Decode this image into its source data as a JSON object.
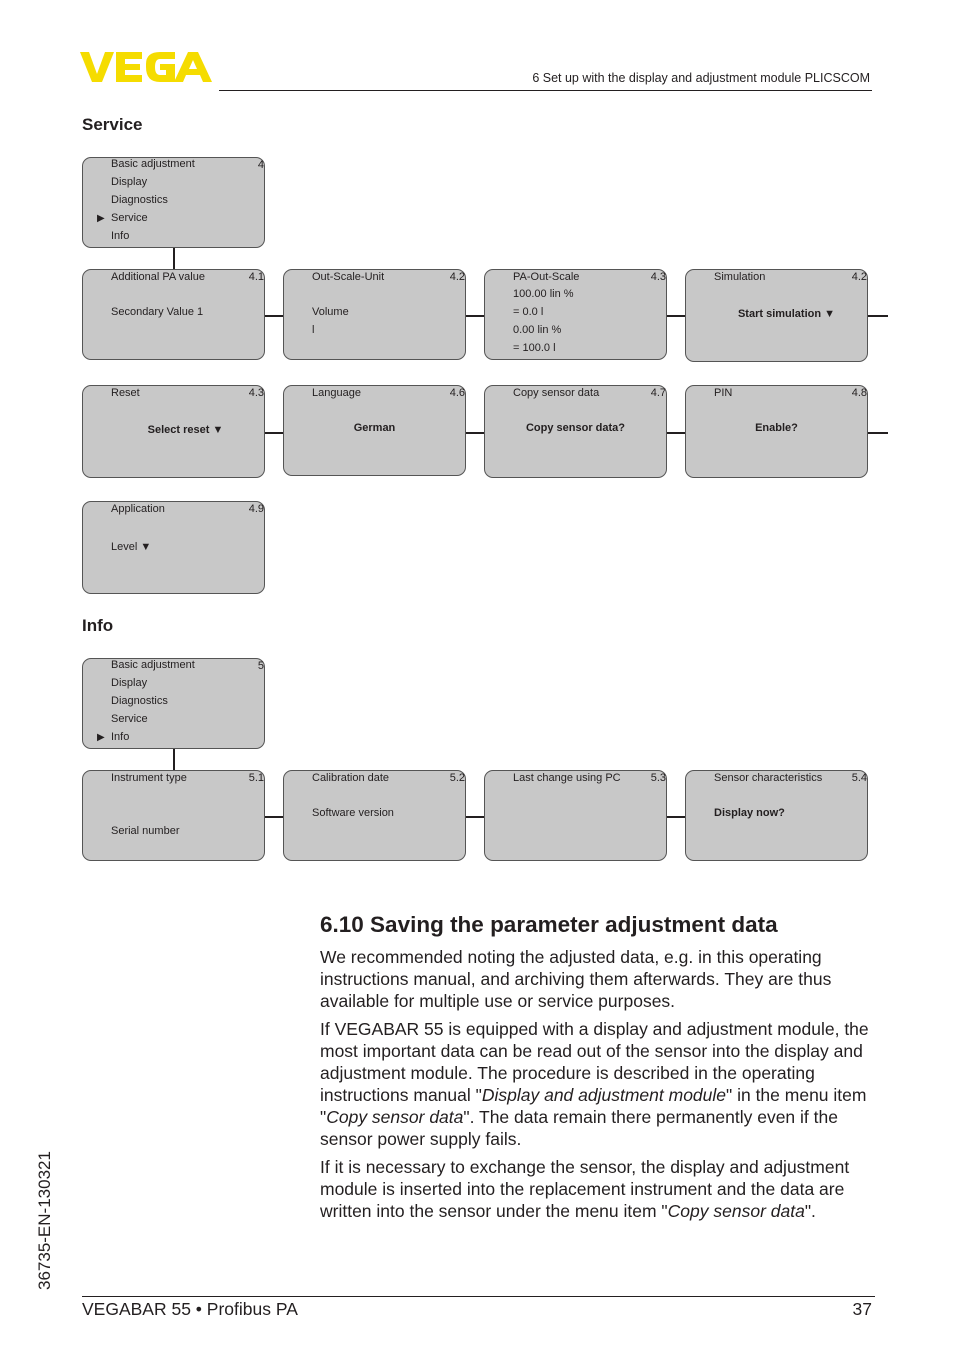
{
  "header": {
    "logo_text": "VEGA",
    "brand_color": "#f5dc00",
    "chapter_title": "6 Set up with the display and adjustment module PLICSCOM"
  },
  "service": {
    "heading": "Service",
    "menu": {
      "items": [
        "Basic adjustment",
        "Display",
        "Diagnostics",
        "Service",
        "Info"
      ],
      "selected_index": 3,
      "number": "4"
    },
    "boxes": [
      {
        "title": "Additional PA value",
        "num": "4.1",
        "lines": [
          "Secondary Value 1"
        ]
      },
      {
        "title": "Out-Scale-Unit",
        "num": "4.2",
        "lines": [
          "Volume",
          "l"
        ]
      },
      {
        "title": "PA-Out-Scale",
        "num": "4.3",
        "lines": [
          "100.00 lin %",
          "= 0.0 l",
          "0.00 lin %",
          "= 100.0 l"
        ]
      },
      {
        "title": "Simulation",
        "num": "4.2",
        "action": "Start simulation ▼"
      },
      {
        "title": "Reset",
        "num": "4.3",
        "action": "Select reset ▼"
      },
      {
        "title": "Language",
        "num": "4.6",
        "action": "German"
      },
      {
        "title": "Copy sensor data",
        "num": "4.7",
        "action": "Copy sensor data?"
      },
      {
        "title": "PIN",
        "num": "4.8",
        "action": "Enable?"
      },
      {
        "title": "Application",
        "num": "4.9",
        "lines": [
          "Level ▼"
        ]
      }
    ]
  },
  "info": {
    "heading": "Info",
    "menu": {
      "items": [
        "Basic adjustment",
        "Display",
        "Diagnostics",
        "Service",
        "Info"
      ],
      "selected_index": 4,
      "number": "5"
    },
    "boxes": [
      {
        "title": "Instrument type",
        "num": "5.1",
        "lines": [
          "Serial number"
        ]
      },
      {
        "title": "Calibration date",
        "num": "5.2",
        "lines": [
          "Software version"
        ]
      },
      {
        "title": "Last change using PC",
        "num": "5.3"
      },
      {
        "title": "Sensor characteristics",
        "num": "5.4",
        "action": "Display now?"
      }
    ]
  },
  "section": {
    "heading": "6.10  Saving the parameter adjustment data",
    "p1": "We recommended noting the adjusted data, e.g. in this operating instructions manual, and archiving them afterwards. They are thus available for multiple use or service purposes.",
    "p2_a": "If VEGABAR 55 is equipped with a display and adjustment module, the most important data can be read out of the sensor into the display and adjustment module. The procedure is described in the operating instructions manual \"",
    "p2_i1": "Display and adjustment module",
    "p2_b": "\" in the menu item \"",
    "p2_i2": "Copy sensor data",
    "p2_c": "\". The data remain there permanently even if the sensor power supply fails.",
    "p3_a": "If it is necessary to exchange the sensor, the display and adjustment module is inserted into the replacement instrument and the data are written into the sensor under the menu item \"",
    "p3_i": "Copy sensor data",
    "p3_b": "\"."
  },
  "footer": {
    "doc_id": "36735-EN-130321",
    "product": "VEGABAR 55 • Profibus PA",
    "page_number": "37"
  },
  "icons": {
    "selected_marker": "▶"
  }
}
